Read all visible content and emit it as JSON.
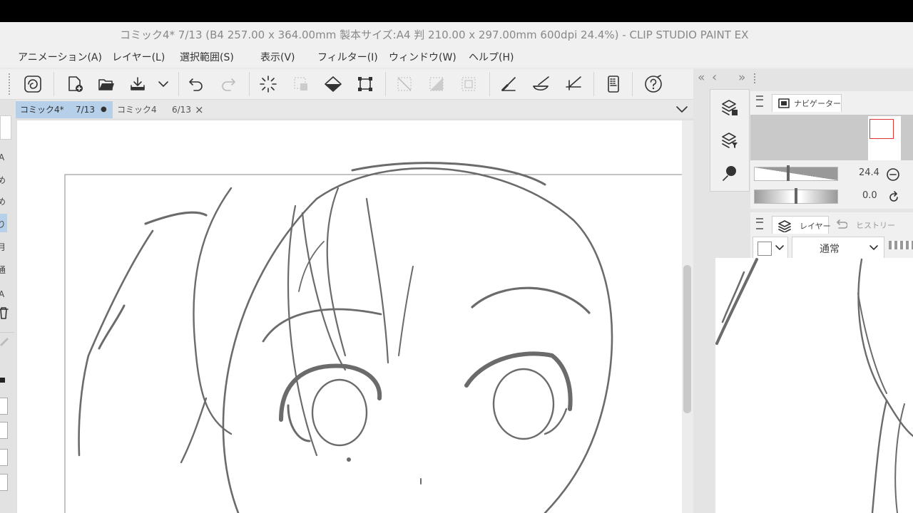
{
  "window": {
    "title": "コミック4* 7/13 (B4 257.00 x 364.00mm 製本サイズ:A4 判 210.00 x 297.00mm 600dpi 24.4%)  - CLIP STUDIO PAINT EX"
  },
  "menu": [
    {
      "label": "アニメーション(A)"
    },
    {
      "label": "レイヤー(L)"
    },
    {
      "label": "選択範囲(S)"
    },
    {
      "label": "表示(V)"
    },
    {
      "label": "フィルター(I)"
    },
    {
      "label": "ウィンドウ(W)"
    },
    {
      "label": "ヘルプ(H)"
    }
  ],
  "toolbar": {
    "icons": [
      "clip-studio-icon",
      "new-page-icon",
      "open-folder-icon",
      "save-icon",
      "chevron-down-icon",
      "undo-icon",
      "redo-icon",
      "loading-icon",
      "select-icon",
      "fill-icon",
      "transform-icon",
      "clear-selection-icon",
      "invert-selection-icon",
      "selection-border-icon",
      "ruler-icon",
      "snap-ruler-icon",
      "perspective-ruler-icon",
      "device-icon",
      "help-icon"
    ]
  },
  "tabs": [
    {
      "name": "コミック4*",
      "page": "7/13",
      "state": "●"
    },
    {
      "name": "コミック4",
      "page": "6/13",
      "state": "×"
    }
  ],
  "panels_header": {
    "collapse": "«",
    "prev": "‹",
    "next": "»"
  },
  "navigator": {
    "tab_label": "ナビゲーター",
    "zoom_value": "24.4",
    "rotation_value": "0.0"
  },
  "layers": {
    "tab_label": "レイヤー",
    "history_label": "ヒストリー",
    "blend_mode": "通常"
  },
  "left_strip": {
    "chars": [
      "A",
      "め",
      "め",
      "り",
      "月",
      "通",
      "A"
    ]
  },
  "colors": {
    "accent_tab": "#b6d0ea",
    "canvas_bg": "#e0e0e0",
    "sketch": "#6b6b6b"
  }
}
